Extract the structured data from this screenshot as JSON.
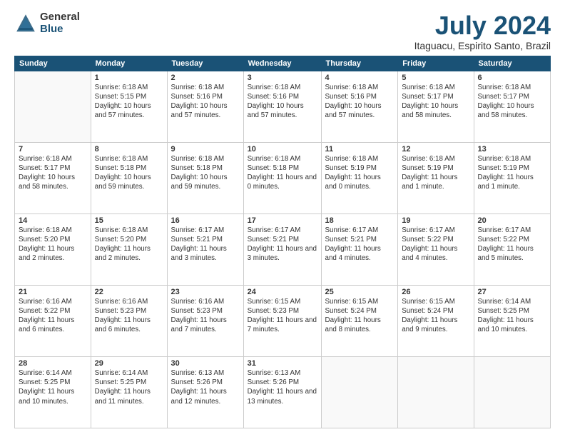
{
  "logo": {
    "general": "General",
    "blue": "Blue"
  },
  "title": "July 2024",
  "location": "Itaguacu, Espirito Santo, Brazil",
  "days_header": [
    "Sunday",
    "Monday",
    "Tuesday",
    "Wednesday",
    "Thursday",
    "Friday",
    "Saturday"
  ],
  "weeks": [
    [
      {
        "num": "",
        "info": ""
      },
      {
        "num": "1",
        "info": "Sunrise: 6:18 AM\nSunset: 5:15 PM\nDaylight: 10 hours and 57 minutes."
      },
      {
        "num": "2",
        "info": "Sunrise: 6:18 AM\nSunset: 5:16 PM\nDaylight: 10 hours and 57 minutes."
      },
      {
        "num": "3",
        "info": "Sunrise: 6:18 AM\nSunset: 5:16 PM\nDaylight: 10 hours and 57 minutes."
      },
      {
        "num": "4",
        "info": "Sunrise: 6:18 AM\nSunset: 5:16 PM\nDaylight: 10 hours and 57 minutes."
      },
      {
        "num": "5",
        "info": "Sunrise: 6:18 AM\nSunset: 5:17 PM\nDaylight: 10 hours and 58 minutes."
      },
      {
        "num": "6",
        "info": "Sunrise: 6:18 AM\nSunset: 5:17 PM\nDaylight: 10 hours and 58 minutes."
      }
    ],
    [
      {
        "num": "7",
        "info": "Sunrise: 6:18 AM\nSunset: 5:17 PM\nDaylight: 10 hours and 58 minutes."
      },
      {
        "num": "8",
        "info": "Sunrise: 6:18 AM\nSunset: 5:18 PM\nDaylight: 10 hours and 59 minutes."
      },
      {
        "num": "9",
        "info": "Sunrise: 6:18 AM\nSunset: 5:18 PM\nDaylight: 10 hours and 59 minutes."
      },
      {
        "num": "10",
        "info": "Sunrise: 6:18 AM\nSunset: 5:18 PM\nDaylight: 11 hours and 0 minutes."
      },
      {
        "num": "11",
        "info": "Sunrise: 6:18 AM\nSunset: 5:19 PM\nDaylight: 11 hours and 0 minutes."
      },
      {
        "num": "12",
        "info": "Sunrise: 6:18 AM\nSunset: 5:19 PM\nDaylight: 11 hours and 1 minute."
      },
      {
        "num": "13",
        "info": "Sunrise: 6:18 AM\nSunset: 5:19 PM\nDaylight: 11 hours and 1 minute."
      }
    ],
    [
      {
        "num": "14",
        "info": "Sunrise: 6:18 AM\nSunset: 5:20 PM\nDaylight: 11 hours and 2 minutes."
      },
      {
        "num": "15",
        "info": "Sunrise: 6:18 AM\nSunset: 5:20 PM\nDaylight: 11 hours and 2 minutes."
      },
      {
        "num": "16",
        "info": "Sunrise: 6:17 AM\nSunset: 5:21 PM\nDaylight: 11 hours and 3 minutes."
      },
      {
        "num": "17",
        "info": "Sunrise: 6:17 AM\nSunset: 5:21 PM\nDaylight: 11 hours and 3 minutes."
      },
      {
        "num": "18",
        "info": "Sunrise: 6:17 AM\nSunset: 5:21 PM\nDaylight: 11 hours and 4 minutes."
      },
      {
        "num": "19",
        "info": "Sunrise: 6:17 AM\nSunset: 5:22 PM\nDaylight: 11 hours and 4 minutes."
      },
      {
        "num": "20",
        "info": "Sunrise: 6:17 AM\nSunset: 5:22 PM\nDaylight: 11 hours and 5 minutes."
      }
    ],
    [
      {
        "num": "21",
        "info": "Sunrise: 6:16 AM\nSunset: 5:22 PM\nDaylight: 11 hours and 6 minutes."
      },
      {
        "num": "22",
        "info": "Sunrise: 6:16 AM\nSunset: 5:23 PM\nDaylight: 11 hours and 6 minutes."
      },
      {
        "num": "23",
        "info": "Sunrise: 6:16 AM\nSunset: 5:23 PM\nDaylight: 11 hours and 7 minutes."
      },
      {
        "num": "24",
        "info": "Sunrise: 6:15 AM\nSunset: 5:23 PM\nDaylight: 11 hours and 7 minutes."
      },
      {
        "num": "25",
        "info": "Sunrise: 6:15 AM\nSunset: 5:24 PM\nDaylight: 11 hours and 8 minutes."
      },
      {
        "num": "26",
        "info": "Sunrise: 6:15 AM\nSunset: 5:24 PM\nDaylight: 11 hours and 9 minutes."
      },
      {
        "num": "27",
        "info": "Sunrise: 6:14 AM\nSunset: 5:25 PM\nDaylight: 11 hours and 10 minutes."
      }
    ],
    [
      {
        "num": "28",
        "info": "Sunrise: 6:14 AM\nSunset: 5:25 PM\nDaylight: 11 hours and 10 minutes."
      },
      {
        "num": "29",
        "info": "Sunrise: 6:14 AM\nSunset: 5:25 PM\nDaylight: 11 hours and 11 minutes."
      },
      {
        "num": "30",
        "info": "Sunrise: 6:13 AM\nSunset: 5:26 PM\nDaylight: 11 hours and 12 minutes."
      },
      {
        "num": "31",
        "info": "Sunrise: 6:13 AM\nSunset: 5:26 PM\nDaylight: 11 hours and 13 minutes."
      },
      {
        "num": "",
        "info": ""
      },
      {
        "num": "",
        "info": ""
      },
      {
        "num": "",
        "info": ""
      }
    ]
  ]
}
